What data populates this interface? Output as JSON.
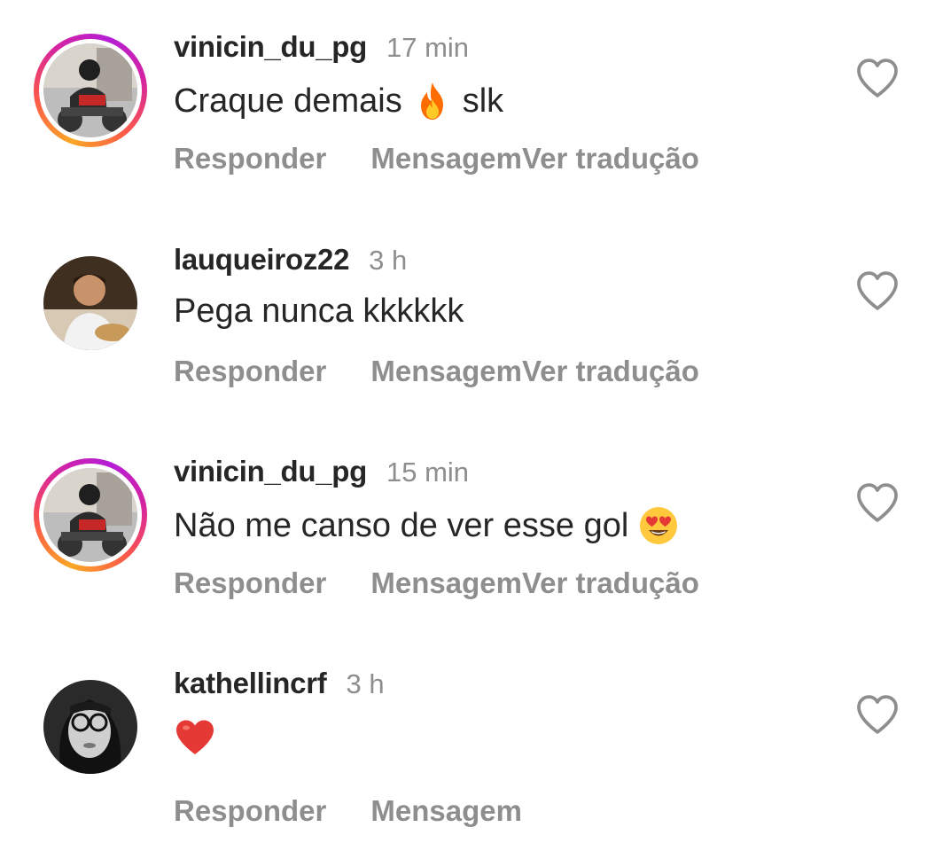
{
  "comments": [
    {
      "username": "vinicin_du_pg",
      "time": "17 min",
      "text_before": "Craque demais",
      "emoji": "fire",
      "text_after": "slk",
      "reply_label": "Responder",
      "message_label": "Mensagem",
      "translate_label": "Ver tradução",
      "has_story_ring": true
    },
    {
      "username": "lauqueiroz22",
      "time": "3 h",
      "text_before": "Pega nunca kkkkkk",
      "emoji": "",
      "text_after": "",
      "reply_label": "Responder",
      "message_label": "Mensagem",
      "translate_label": "Ver tradução",
      "has_story_ring": false
    },
    {
      "username": "vinicin_du_pg",
      "time": "15 min",
      "text_before": "Não me  canso de ver esse gol",
      "emoji": "heart-eyes",
      "text_after": "",
      "reply_label": "Responder",
      "message_label": "Mensagem",
      "translate_label": "Ver tradução",
      "has_story_ring": true
    },
    {
      "username": "kathellincrf",
      "time": "3 h",
      "text_before": "",
      "emoji": "red-heart",
      "text_after": "",
      "reply_label": "Responder",
      "message_label": "Mensagem",
      "translate_label": "",
      "has_story_ring": false
    }
  ],
  "colors": {
    "username": "#262626",
    "meta": "#8e8e8e",
    "like_outline": "#8e8e8e"
  }
}
